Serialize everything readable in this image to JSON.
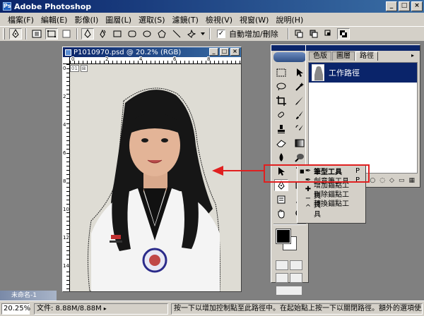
{
  "app": {
    "title": "Adobe Photoshop"
  },
  "window_controls": {
    "minimize": "_",
    "maximize": "□",
    "close": "×"
  },
  "menu": {
    "items": [
      "檔案(F)",
      "編輯(E)",
      "影像(I)",
      "圖層(L)",
      "選取(S)",
      "濾鏡(T)",
      "檢視(V)",
      "視窗(W)",
      "說明(H)"
    ]
  },
  "options_bar": {
    "auto_add_delete_label": "自動增加/刪除",
    "auto_add_delete_checked": true,
    "check_glyph": "✓"
  },
  "document": {
    "title": "P1010970.psd @ 20.2% (RGB)",
    "ruler_top_labels": [
      "0",
      "2",
      "4",
      "6",
      "8"
    ],
    "ruler_left_labels": [
      "0",
      "2",
      "4",
      "6",
      "8",
      "10",
      "12",
      "14"
    ],
    "layer_badge": [
      "01",
      "⊠"
    ]
  },
  "tool_flyout": {
    "items": [
      {
        "label": "筆型工具",
        "key": "P",
        "icon": "pen-icon",
        "glyph": "✒",
        "selected": true
      },
      {
        "label": "創意筆工具",
        "key": "P",
        "icon": "freeform-pen-icon",
        "glyph": "✒",
        "selected": false
      },
      {
        "label": "增加錨點工具",
        "key": "",
        "icon": "add-anchor-icon",
        "glyph": "✚",
        "selected": false
      },
      {
        "label": "刪除錨點工具",
        "key": "",
        "icon": "delete-anchor-icon",
        "glyph": "−",
        "selected": false
      },
      {
        "label": "轉換錨點工具",
        "key": "",
        "icon": "convert-anchor-icon",
        "glyph": "^",
        "selected": false
      }
    ]
  },
  "paths_panel": {
    "tabs": [
      "色版",
      "圖層",
      "路徑"
    ],
    "active_tab": "路徑",
    "items": [
      {
        "label": "工作路徑",
        "selected": true
      }
    ],
    "menu_glyph": "▸"
  },
  "status_bar": {
    "zoom": "20.25%",
    "doc_info": "文件: 8.88M/8.88M",
    "doc_arrow": "▸",
    "hint": "按一下以增加控制點至此路徑中。在起始點上按一下以關閉路徑。額外的選項使用 Sh"
  },
  "minimized_doc": {
    "title": "未命名-1"
  },
  "colors": {
    "title_bar": "#0a246a",
    "chrome": "#d4d0c8",
    "workspace": "#808080",
    "highlight": "#e02020",
    "foreground": "#000000",
    "background": "#ffffff"
  }
}
